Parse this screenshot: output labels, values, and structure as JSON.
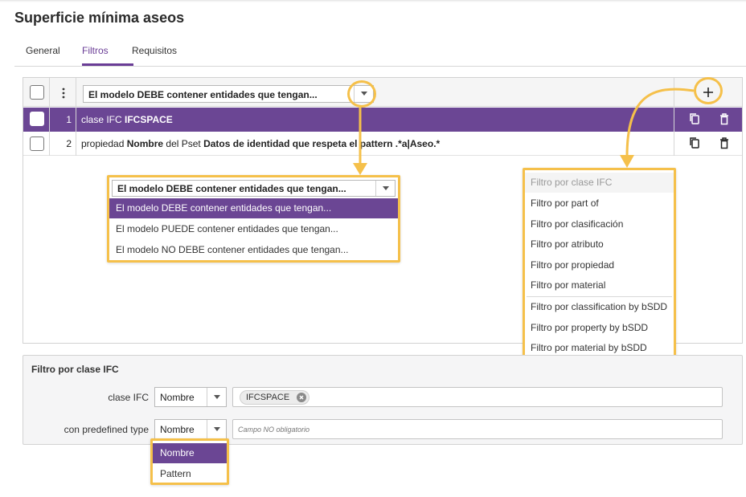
{
  "page": {
    "title": "Superficie mínima aseos"
  },
  "tabs": [
    {
      "label": "General"
    },
    {
      "label": "Filtros"
    },
    {
      "label": "Requisitos"
    }
  ],
  "grid": {
    "header_select_value": "El modelo DEBE contener entidades que tengan...",
    "rows": [
      {
        "num": "1",
        "prefix": "clase IFC ",
        "bold": "IFCSPACE"
      },
      {
        "num": "2",
        "p1": "propiedad ",
        "b1": "Nombre",
        "p2": " del Pset ",
        "b2": "Datos de identidad que respeta el pattern .*a|Aseo.*"
      }
    ]
  },
  "mode_dropdown": {
    "value": "El modelo DEBE contener entidades que tengan...",
    "options": [
      "El modelo DEBE contener entidades que tengan...",
      "El modelo PUEDE contener entidades que tengan...",
      "El modelo NO DEBE contener entidades que tengan..."
    ]
  },
  "add_filter_menu": {
    "items": [
      "Filtro por clase IFC",
      "Filtro por part of",
      "Filtro por clasificación",
      "Filtro por atributo",
      "Filtro por propiedad",
      "Filtro por material",
      "Filtro por classification by bSDD",
      "Filtro por property by bSDD",
      "Filtro por material by bSDD"
    ]
  },
  "filter_panel": {
    "title": "Filtro por clase IFC",
    "class_label": "clase IFC",
    "class_mode": "Nombre",
    "class_chip": "IFCSPACE",
    "type_label": "con predefined type",
    "type_mode": "Nombre",
    "type_placeholder": "Campo NO obligatorio"
  },
  "type_mode_dropdown": {
    "options": [
      "Nombre",
      "Pattern"
    ]
  },
  "colors": {
    "accent": "#6b4694",
    "highlight": "#f5c04a"
  }
}
